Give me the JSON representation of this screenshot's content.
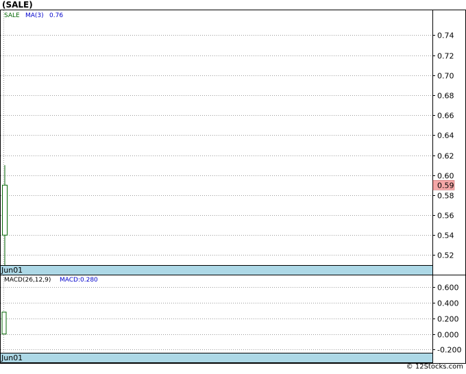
{
  "title": "(SALE)",
  "footer": "© 12Stocks.com",
  "colors": {
    "price_line": "#006400",
    "ma_label": "#0000cc",
    "macd_label": "#0000cc",
    "date_bar": "#add8e6",
    "last_price_bg": "#f4a7a7",
    "grid": "#999999"
  },
  "chart_data": [
    {
      "type": "candlestick",
      "legend": {
        "symbol": "SALE",
        "ma_label": "MA(3)",
        "ma_value": "0.76"
      },
      "ylim": [
        0.51,
        0.765
      ],
      "y_ticks": [
        0.74,
        0.72,
        0.7,
        0.68,
        0.66,
        0.64,
        0.62,
        0.6,
        0.58,
        0.56,
        0.54,
        0.52
      ],
      "y_tick_labels": [
        "0.74",
        "0.72",
        "0.70",
        "0.68",
        "0.66",
        "0.64",
        "0.62",
        "0.60",
        "0.58",
        "0.56",
        "0.54",
        "0.52"
      ],
      "last_price": 0.59,
      "last_price_label": "0.59",
      "candles": [
        {
          "date": "Jun01",
          "open": 0.54,
          "close": 0.59,
          "high": 0.61,
          "low": 0.51
        }
      ],
      "x_labels": [
        "Jun01"
      ],
      "grid": true
    },
    {
      "type": "bar",
      "legend": {
        "label": "MACD(26,12,9)",
        "value_label": "MACD:0.280"
      },
      "ylim": [
        -0.24,
        0.75
      ],
      "y_ticks": [
        0.6,
        0.4,
        0.2,
        0.0,
        -0.2
      ],
      "y_tick_labels": [
        "0.600",
        "0.400",
        "0.200",
        "0.000",
        "-0.200"
      ],
      "values": [
        {
          "date": "Jun01",
          "value": 0.28
        }
      ],
      "x_labels": [
        "Jun01"
      ],
      "grid": true
    }
  ]
}
